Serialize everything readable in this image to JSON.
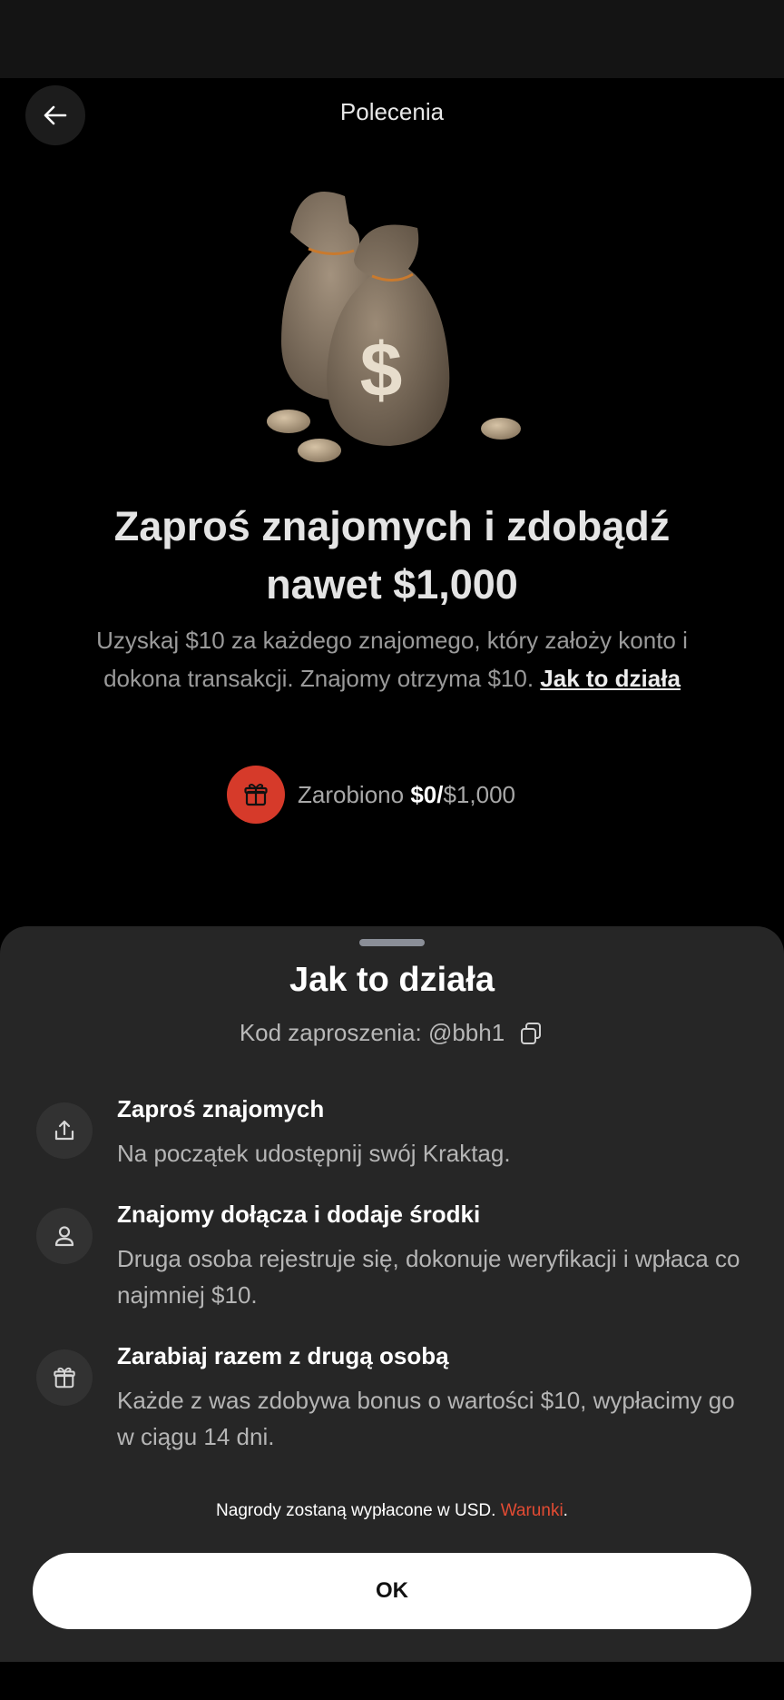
{
  "header": {
    "title": "Polecenia",
    "back_icon": "arrow-left-icon"
  },
  "hero": {
    "image": "money-bags-illustration",
    "symbol": "$"
  },
  "headline": {
    "line1": "Zaproś znajomych i zdobądź",
    "line2": "nawet $1,000"
  },
  "subtext": {
    "line1": "Uzyskaj $10 za każdego znajomego, który założy konto i",
    "line2": "dokona transakcji. Znajomy otrzyma $10.",
    "link": "Jak to działa"
  },
  "earned": {
    "label": "Zarobiono",
    "amount": "$0",
    "separator": "/",
    "total": "$1,000",
    "icon": "gift-icon",
    "badge_color": "#d63a2a"
  },
  "sheet": {
    "title": "Jak to działa",
    "invite_label": "Kod zaproszenia: @bbh1",
    "copy_icon": "copy-icon",
    "steps": [
      {
        "icon": "share-icon",
        "title": "Zaproś znajomych",
        "desc": "Na początek udostępnij swój Kraktag."
      },
      {
        "icon": "person-icon",
        "title": "Znajomy dołącza i dodaje środki",
        "desc": "Druga osoba rejestruje się, dokonuje weryfikacji i wpłaca co najmniej $10."
      },
      {
        "icon": "gift-icon",
        "title": "Zarabiaj razem z drugą osobą",
        "desc": "Każde z was zdobywa bonus o wartości $10, wypłacimy go w ciągu 14 dni."
      }
    ],
    "footnote": "Nagrody zostaną wypłacone w USD.",
    "terms_link": "Warunki",
    "footnote_end": ".",
    "ok_label": "OK",
    "accent_color": "#e24b33"
  }
}
